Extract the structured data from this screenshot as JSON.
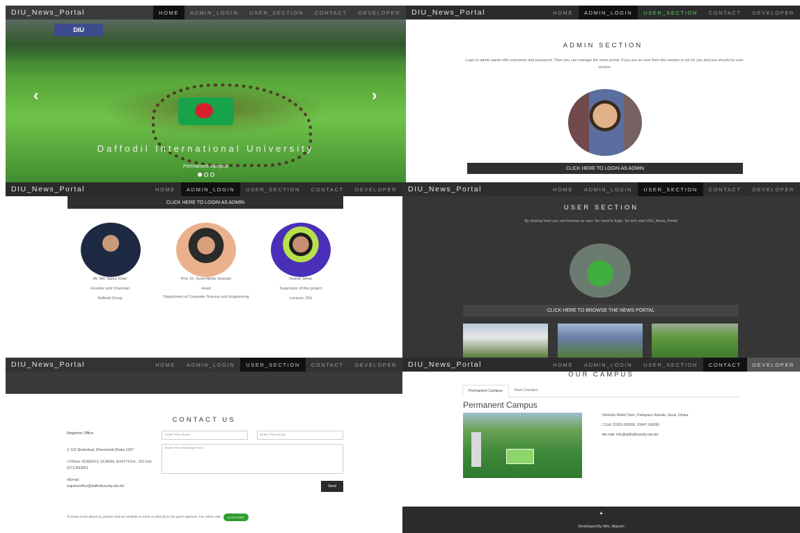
{
  "brand": "DIU_News_Portal",
  "nav": [
    "HOME",
    "ADMIN_LOGIN",
    "USER_SECTION",
    "CONTACT",
    "DEVELOPER"
  ],
  "hero": {
    "title": "Daffodil International University",
    "caption": "Permanent campus",
    "prev_icon": "‹",
    "next_icon": "›",
    "building_label": "DIU"
  },
  "admin": {
    "title": "ADMIN SECTION",
    "description": "Login to admin panel with username and password. Then you can manage the news portal. If you are an user then this section is not for you and you should try user section",
    "button": "CLICK HERE TO LOGIN AS ADMIN"
  },
  "people": [
    {
      "name": "Mr. Md. Sabur Khan",
      "role": "Founder and Chairman",
      "org": "Daffodil Group"
    },
    {
      "name": "Prof. Dr. Syed Akhter Hossain",
      "role": "Head",
      "org": "Department of Computer Science and Engineering"
    },
    {
      "name": "Nusrat Jahan",
      "role": "Supervisor of this project",
      "org": "Lecturer, DIU"
    }
  ],
  "user": {
    "title": "USER SECTION",
    "description": "By clicking here you can browse as user. No need to login. So let's start DIU_News_Portal",
    "button": "CLICK HERE TO BROWSE THE NEWS PORTAL"
  },
  "contact": {
    "title": "CONTACT US",
    "office_heading": "Registrar Office",
    "address": "102 Shukrabad, Dhanmondi,Dhaka-1207",
    "phone": "Phone: 9138234-5, 9136694, 9116774 Ext.: 103 Cell: 01713493051",
    "email_label": "Email:",
    "email": "registraroffice@daffodilvarsity.edu.bd",
    "name_placeholder": "Enter Your Name",
    "email_placeholder": "Enter Your Email",
    "message_placeholder": "Enter Your Message Here...",
    "send": "Send",
    "footer_text": "To know more about us, please visit our website or meet us directly to the given address. For online visit",
    "footer_button": "CLICK HERE"
  },
  "campus": {
    "title": "OUR CAMPUS",
    "tabs": [
      "Permanent Campus",
      "Main Campus"
    ],
    "heading": "Permanent Campus",
    "address": "Ashulia Model Town, Dattapara, Ashulia, Savar, Dhaka",
    "cell": "Cell: 01833-102806, 01847-140066",
    "email": "E-mail: info@daffodilvarsity.edu.bd",
    "footer": "Developed By Mhr_Masum",
    "up_icon": "▲"
  }
}
